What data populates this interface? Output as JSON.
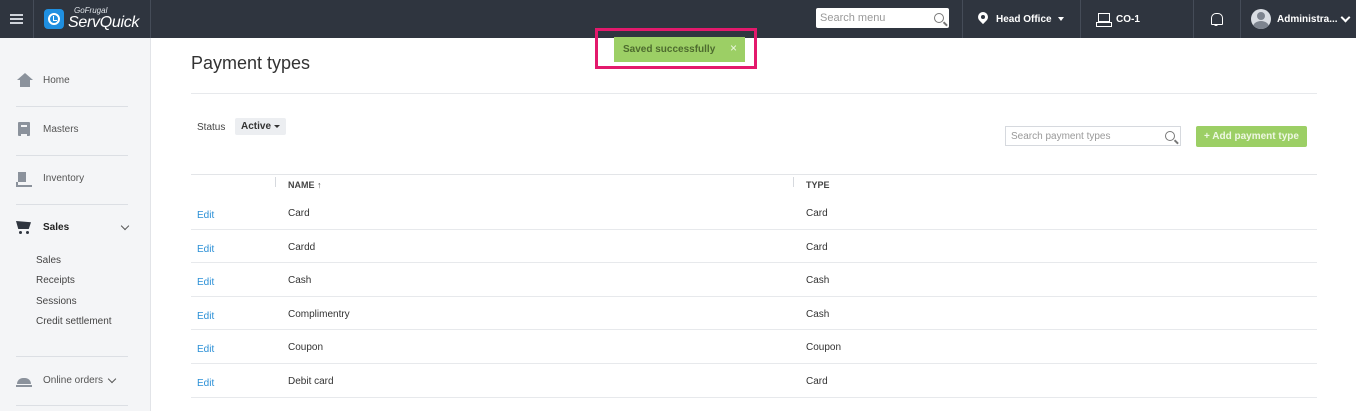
{
  "topbar": {
    "brand_sub": "GoFrugal",
    "brand_main": "ServQuick",
    "search_placeholder": "Search menu",
    "location": "Head Office",
    "counter": "CO-1",
    "user": "Administra..."
  },
  "sidebar": {
    "items": [
      {
        "label": "Home",
        "icon": "home-icon"
      },
      {
        "label": "Masters",
        "icon": "masters-icon"
      },
      {
        "label": "Inventory",
        "icon": "inventory-icon"
      },
      {
        "label": "Sales",
        "icon": "cart-icon"
      },
      {
        "label": "Online orders",
        "icon": "online-orders-icon"
      }
    ],
    "sales_sub": [
      "Sales",
      "Receipts",
      "Sessions",
      "Credit settlement"
    ]
  },
  "main": {
    "title": "Payment types",
    "status_label": "Status",
    "status_value": "Active",
    "search_placeholder": "Search payment types",
    "add_button": "+ Add payment type",
    "columns": {
      "name": "NAME ↑",
      "type": "TYPE"
    },
    "edit_label": "Edit",
    "rows": [
      {
        "name": "Card",
        "type": "Card"
      },
      {
        "name": "Cardd",
        "type": "Card"
      },
      {
        "name": "Cash",
        "type": "Cash"
      },
      {
        "name": "Complimentry",
        "type": "Cash"
      },
      {
        "name": "Coupon",
        "type": "Coupon"
      },
      {
        "name": "Debit card",
        "type": "Card"
      }
    ]
  },
  "toast": {
    "message": "Saved successfully",
    "close": "×"
  },
  "colors": {
    "topbar": "#2f353f",
    "accent_green": "#9ccf65",
    "link_blue": "#2a8fd6",
    "highlight": "#e3196c"
  }
}
